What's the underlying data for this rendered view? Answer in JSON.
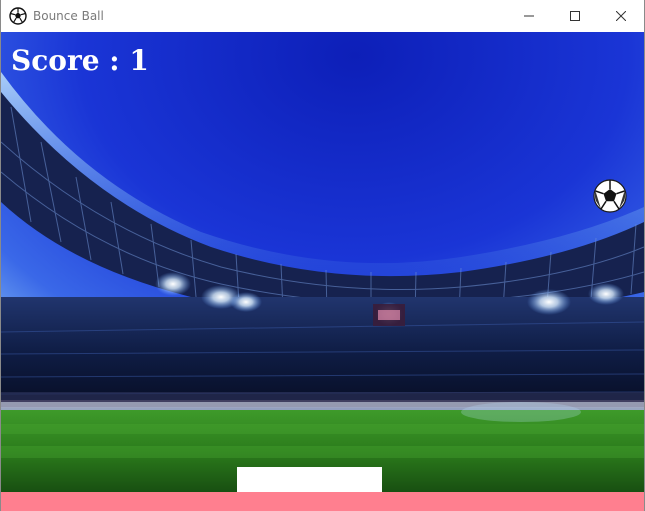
{
  "window": {
    "title": "Bounce Ball",
    "app_icon": "soccer-ball-icon",
    "controls": [
      "minimize-icon",
      "maximize-icon",
      "close-icon"
    ]
  },
  "game": {
    "score_text": "Score : 1",
    "score_value": 1,
    "background": "stadium-night-image",
    "ball_icon": "soccer-ball-icon",
    "paddle_color": "#ffffff",
    "floor_color": "#ff7f8f",
    "sky_color": "#1a2fcf"
  }
}
